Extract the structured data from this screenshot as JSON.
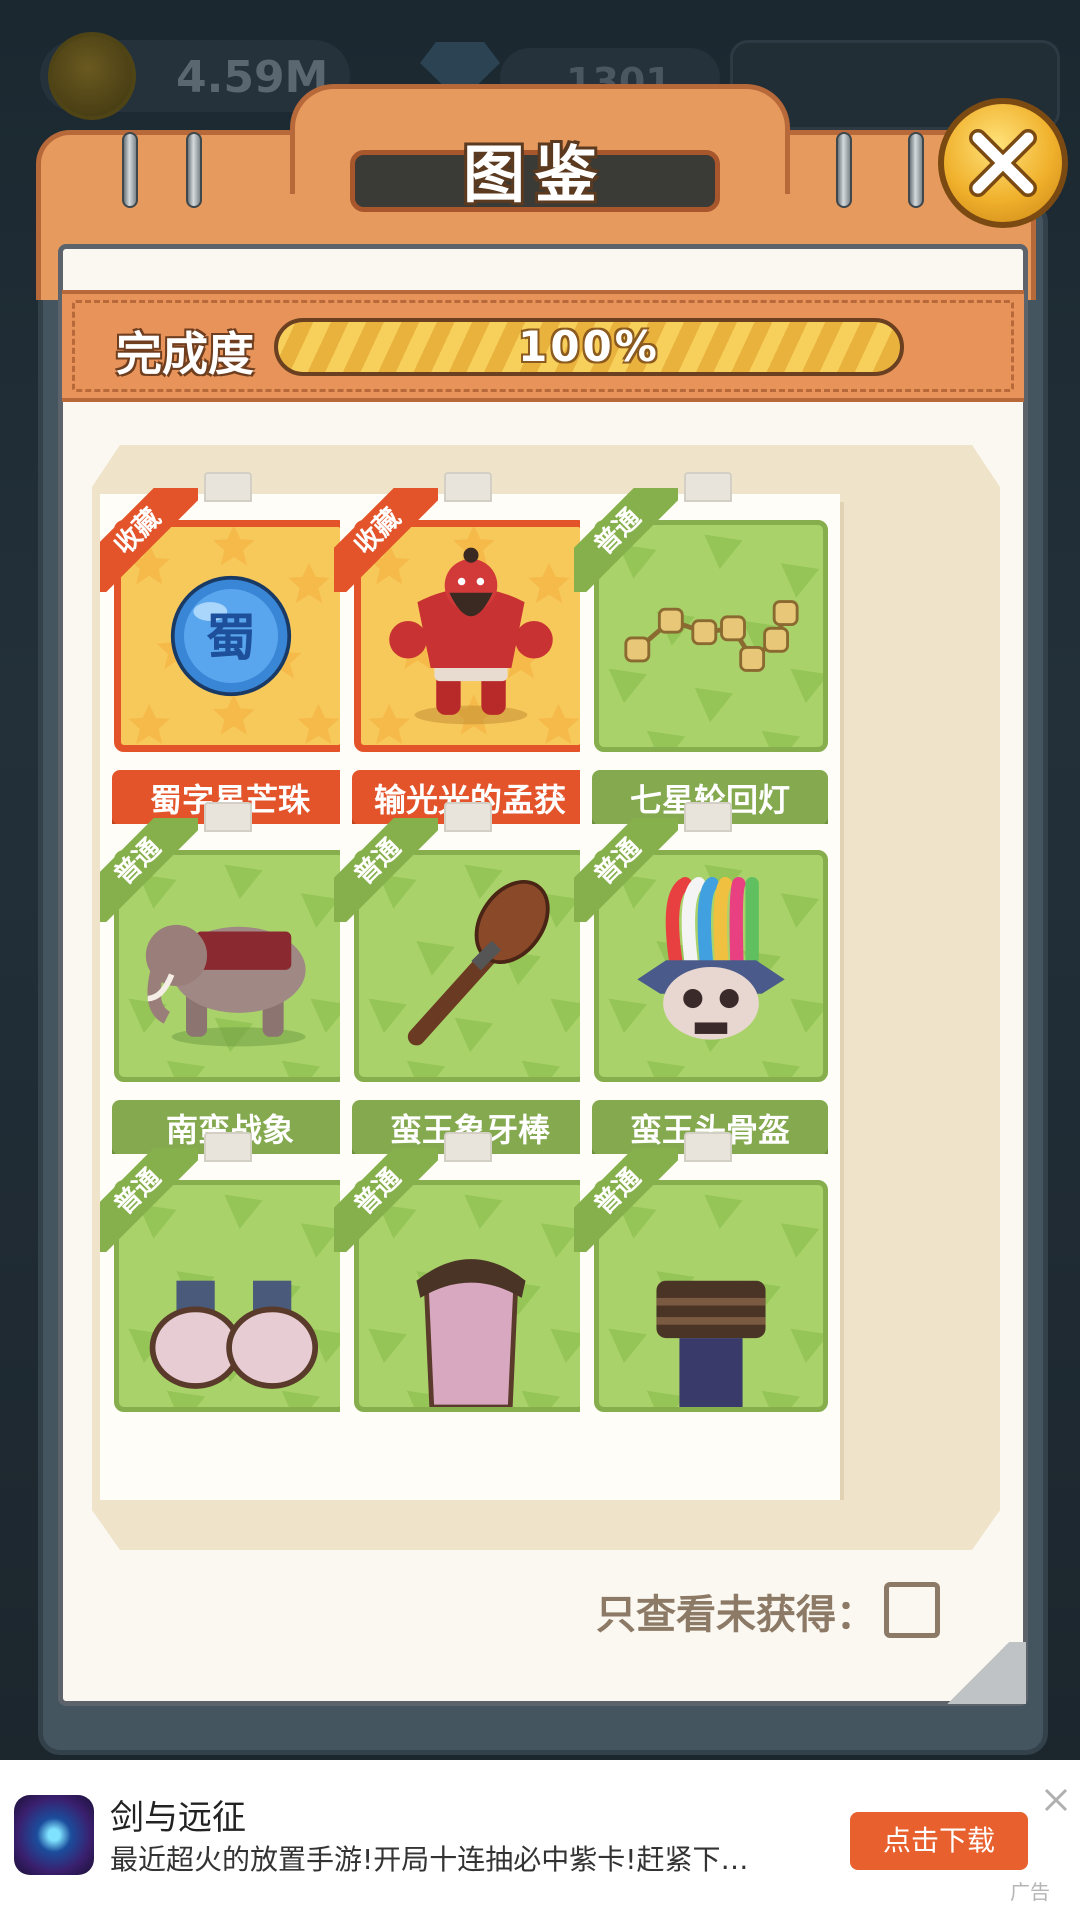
{
  "hud": {
    "coins": "4.59M",
    "gems": "1301"
  },
  "dialog": {
    "title": "图鉴",
    "progress_label": "完成度",
    "progress_value": 1.0,
    "progress_text": "100%",
    "filter_label": "只查看未获得：",
    "filter_checked": false
  },
  "cards": [
    {
      "tag": "收藏",
      "name": "蜀字星芒珠",
      "rarity": "rare",
      "icon": "blue-orb-icon",
      "orb_text": "蜀"
    },
    {
      "tag": "收藏",
      "name": "输光光的孟获",
      "rarity": "rare",
      "icon": "red-ogre-icon"
    },
    {
      "tag": "普通",
      "name": "七星轮回灯",
      "rarity": "common",
      "icon": "seven-star-lamp-icon"
    },
    {
      "tag": "普通",
      "name": "南蛮战象",
      "rarity": "common",
      "icon": "war-elephant-icon"
    },
    {
      "tag": "普通",
      "name": "蛮王象牙棒",
      "rarity": "common",
      "icon": "ivory-club-icon"
    },
    {
      "tag": "普通",
      "name": "蛮王头骨盔",
      "rarity": "common",
      "icon": "skull-helmet-icon"
    },
    {
      "tag": "普通",
      "name": "",
      "rarity": "common",
      "icon": "fur-gauntlets-icon"
    },
    {
      "tag": "普通",
      "name": "",
      "rarity": "common",
      "icon": "fur-boots-icon"
    },
    {
      "tag": "普通",
      "name": "",
      "rarity": "common",
      "icon": "fur-belt-icon"
    }
  ],
  "ad": {
    "title": "剑与远征",
    "description": "最近超火的放置手游!开局十连抽必中紫卡!赶紧下…",
    "button_label": "点击下载",
    "tag": "广告"
  }
}
